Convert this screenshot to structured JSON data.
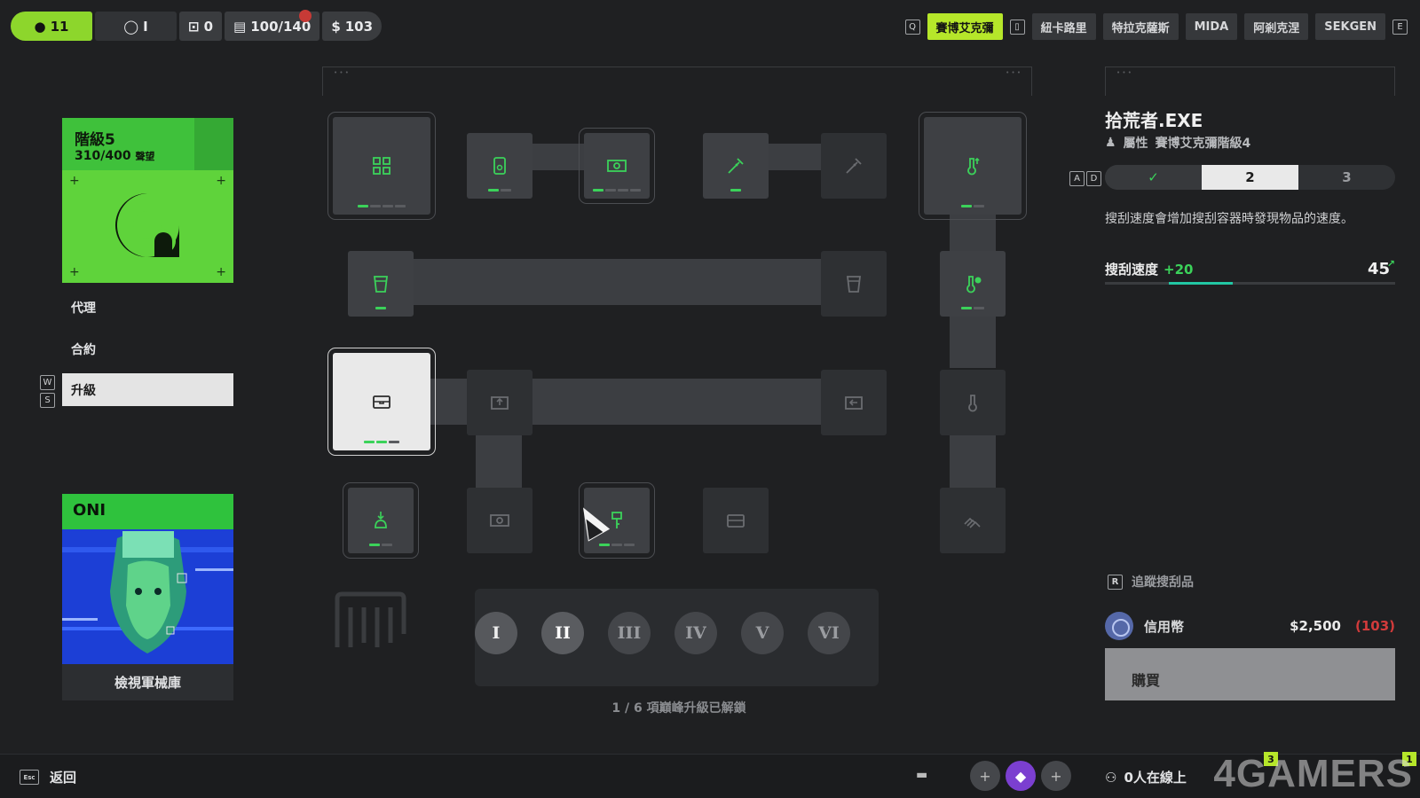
{
  "topbar": {
    "level_value": "11",
    "slot_value": "I",
    "box_value": "0",
    "capacity_value": "100/140",
    "currency_value": "103",
    "tabs": [
      "賽博艾克彌",
      "紐卡路里",
      "特拉克薩斯",
      "MIDA",
      "阿剎克涅",
      "SEKGEN"
    ],
    "active_tab": "賽博艾克彌",
    "left_key": "Q",
    "right_key": "E"
  },
  "rank": {
    "title": "階級5",
    "progress": "310/400",
    "progress_unit": "聲望"
  },
  "menu": {
    "items": [
      "代理",
      "合約",
      "升級"
    ],
    "selected": "升級",
    "key_up": "W",
    "key_down": "S"
  },
  "armory": {
    "head": "ONI",
    "foot": "檢視軍械庫"
  },
  "tree": {
    "tiers": [
      "I",
      "II",
      "III",
      "IV",
      "V",
      "VI"
    ],
    "current_tier": "II",
    "unlock_text": "1 / 6 項巔峰升級已解鎖"
  },
  "detail": {
    "title": "拾荒者.EXE",
    "attr_label": "屬性",
    "attr_value": "賽博艾克彌階級4",
    "key_a": "A",
    "key_d": "D",
    "levels": [
      "✓",
      "2",
      "3"
    ],
    "level_done": 0.33,
    "description": "搜刮速度會增加搜刮容器時發現物品的速度。",
    "stat_label": "搜刮速度",
    "stat_bonus": "+20",
    "stat_value": "45",
    "track_key": "R",
    "track_label": "追蹤搜刮品",
    "credit_label": "信用幣",
    "credit_price": "2,500",
    "credit_have": "(103)",
    "buy_label": "購買"
  },
  "bottombar": {
    "back_key": "Esc",
    "back_label": "返回",
    "online_label": "0人在線上",
    "mail_badge": "3",
    "extra_badge": "1"
  },
  "watermark": "4GAMERS",
  "colors": {
    "accent_green": "#3bd25a",
    "tab_active": "#b6e72a",
    "rank_green": "#5fd33b",
    "warning_red": "#d23b3b"
  }
}
